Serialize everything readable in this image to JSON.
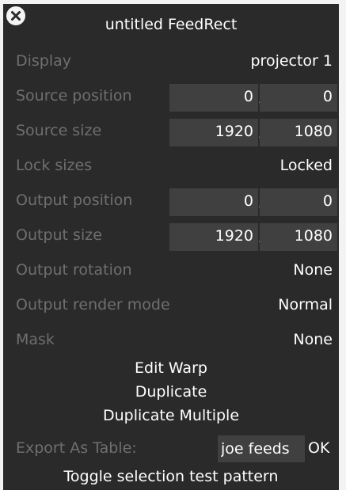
{
  "window": {
    "title": "untitled FeedRect",
    "close_icon": "close-icon"
  },
  "fields": {
    "display": {
      "label": "Display",
      "value": "projector 1"
    },
    "source_position": {
      "label": "Source position",
      "x": "0",
      "y": "0"
    },
    "source_size": {
      "label": "Source size",
      "w": "1920",
      "h": "1080"
    },
    "lock_sizes": {
      "label": "Lock sizes",
      "value": "Locked"
    },
    "output_position": {
      "label": "Output position",
      "x": "0",
      "y": "0"
    },
    "output_size": {
      "label": "Output size",
      "w": "1920",
      "h": "1080"
    },
    "output_rotation": {
      "label": "Output rotation",
      "value": "None"
    },
    "output_render_mode": {
      "label": "Output render mode",
      "value": "Normal"
    },
    "mask": {
      "label": "Mask",
      "value": "None"
    }
  },
  "actions": {
    "edit_warp": "Edit Warp",
    "duplicate": "Duplicate",
    "duplicate_multiple": "Duplicate Multiple",
    "toggle_test_pattern": "Toggle selection test pattern"
  },
  "export": {
    "label": "Export As Table:",
    "value": "joe feeds",
    "ok_label": "OK"
  },
  "separator": ",",
  "colors": {
    "panel_bg": "#2a2a2a",
    "field_bg": "#404040",
    "label_text": "#6f6f6f",
    "value_text": "#ffffff",
    "page_bg": "#f3f3f3"
  }
}
